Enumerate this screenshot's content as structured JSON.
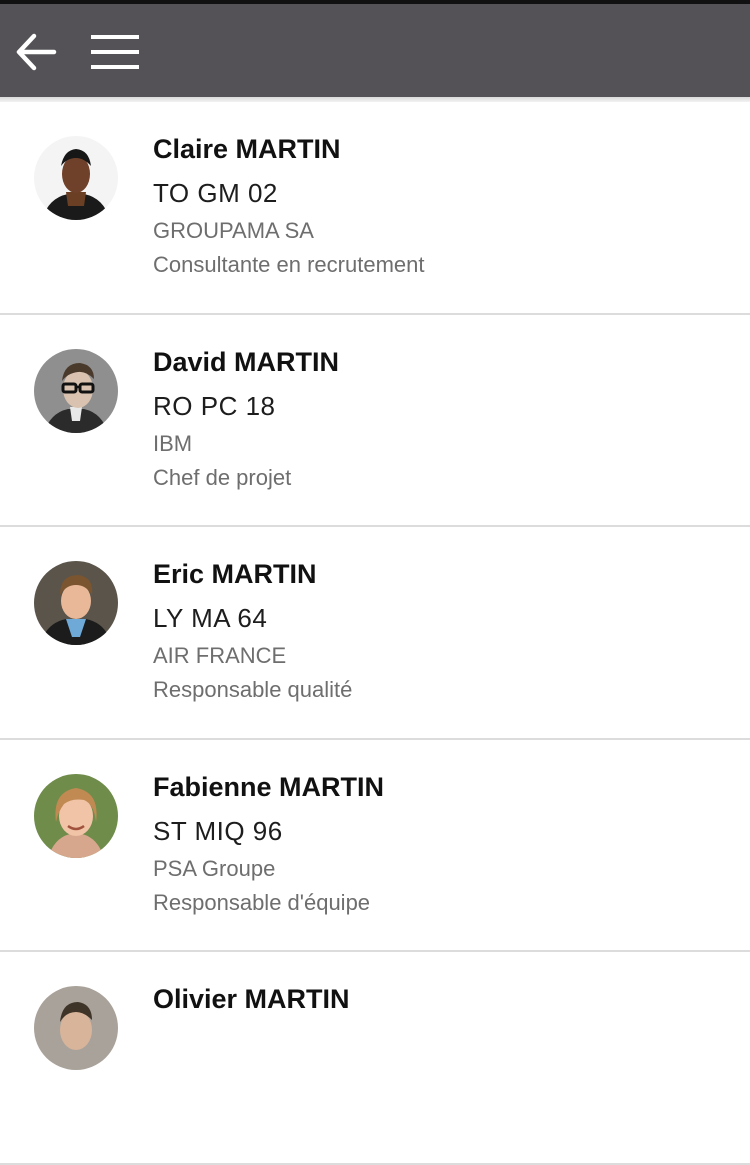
{
  "header": {
    "back_icon": "arrow-left-icon",
    "menu_icon": "hamburger-menu-icon",
    "background_color": "#545256"
  },
  "contacts": [
    {
      "name": "Claire MARTIN",
      "code": "TO GM 02",
      "company": "GROUPAMA SA",
      "role": "Consultante en recrutement"
    },
    {
      "name": "David MARTIN",
      "code": "RO PC 18",
      "company": "IBM",
      "role": "Chef de projet"
    },
    {
      "name": "Eric MARTIN",
      "code": "LY MA 64",
      "company": "AIR FRANCE",
      "role": "Responsable qualité"
    },
    {
      "name": "Fabienne MARTIN",
      "code": "ST MIQ 96",
      "company": "PSA Groupe",
      "role": "Responsable d'équipe"
    },
    {
      "name": "Olivier MARTIN",
      "code": "",
      "company": "",
      "role": ""
    }
  ]
}
